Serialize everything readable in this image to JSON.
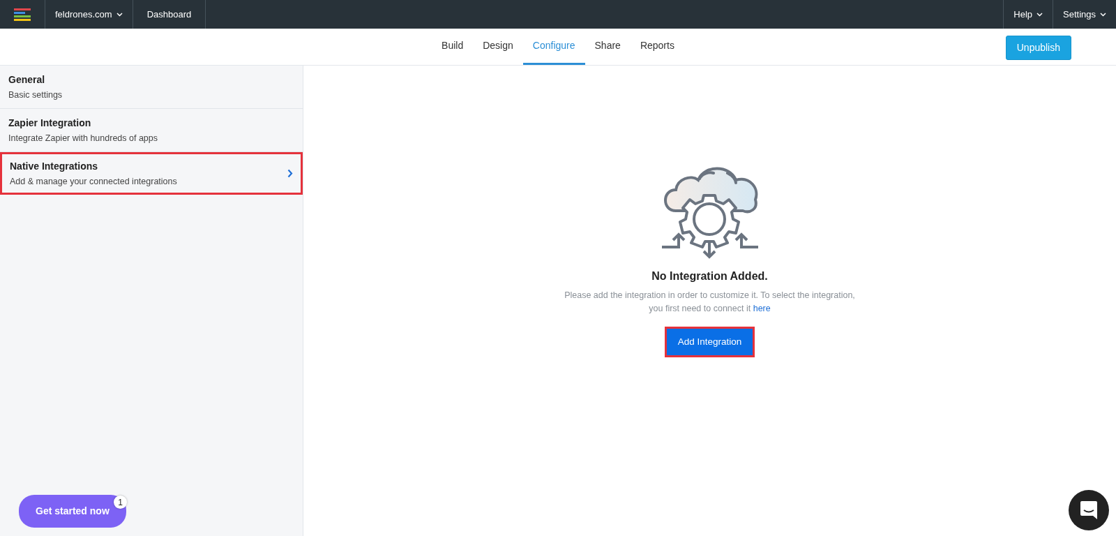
{
  "topbar": {
    "site": "feldrones.com",
    "links": [
      "Dashboard"
    ],
    "right_menus": [
      "Help",
      "Settings"
    ]
  },
  "tabs": [
    {
      "label": "Build",
      "selected": false
    },
    {
      "label": "Design",
      "selected": false
    },
    {
      "label": "Configure",
      "selected": true
    },
    {
      "label": "Share",
      "selected": false
    },
    {
      "label": "Reports",
      "selected": false
    }
  ],
  "publish_button": "Unpublish",
  "sidebar": {
    "items": [
      {
        "title": "General",
        "subtitle": "Basic settings",
        "selected": false,
        "highlighted": false
      },
      {
        "title": "Zapier Integration",
        "subtitle": "Integrate Zapier with hundreds of apps",
        "selected": false,
        "highlighted": false
      },
      {
        "title": "Native Integrations",
        "subtitle": "Add & manage your connected integrations",
        "selected": true,
        "highlighted": true
      }
    ]
  },
  "empty_state": {
    "title": "No Integration Added.",
    "message_line_1": "Please add the integration in order to customize it. To select the integration,",
    "message_line_2": "you first need to connect it",
    "link": "here",
    "button": "Add Integration",
    "button_highlighted": true
  },
  "get_started": {
    "label": "Get started now",
    "badge": "1"
  }
}
